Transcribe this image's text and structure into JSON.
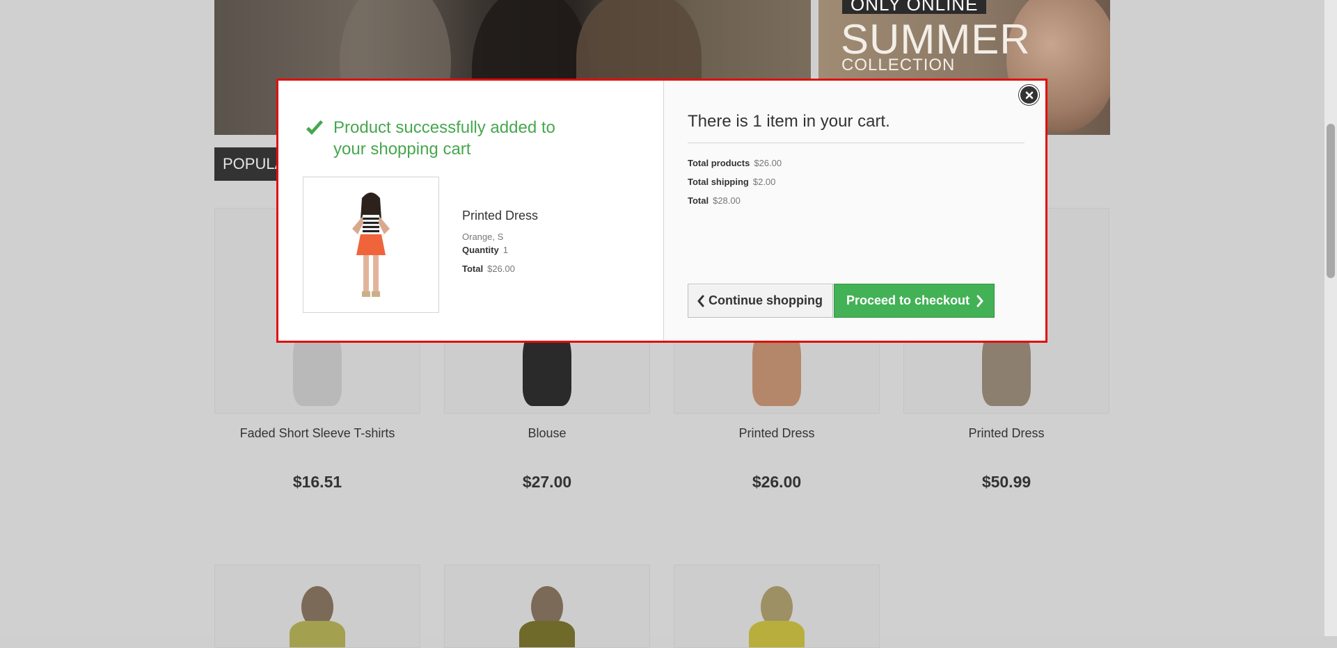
{
  "banner": {
    "right_tag": "ONLY ONLINE",
    "right_title": "SUMMER",
    "right_subtitle": "COLLECTION"
  },
  "section": {
    "tab_label": "POPULAR"
  },
  "products": [
    {
      "name": "Faded Short Sleeve T-shirts",
      "price": "$16.51"
    },
    {
      "name": "Blouse",
      "price": "$27.00"
    },
    {
      "name": "Printed Dress",
      "price": "$26.00"
    },
    {
      "name": "Printed Dress",
      "price": "$50.99"
    }
  ],
  "modal": {
    "success_message": "Product successfully added to your shopping cart",
    "product": {
      "name": "Printed Dress",
      "attributes": "Orange, S",
      "quantity_label": "Quantity",
      "quantity": "1",
      "total_label": "Total",
      "total": "$26.00"
    },
    "cart": {
      "title": "There is 1 item in your cart.",
      "total_products_label": "Total products",
      "total_products": "$26.00",
      "total_shipping_label": "Total shipping",
      "total_shipping": "$2.00",
      "total_label": "Total",
      "total": "$28.00"
    },
    "continue_label": "Continue shopping",
    "checkout_label": "Proceed to checkout"
  },
  "colors": {
    "success_green": "#46a74e",
    "checkout_button": "#43b155",
    "modal_border": "#e10e0e",
    "overlay": "#d0d0d0"
  },
  "icons": [
    "check-icon",
    "close-icon",
    "chevron-left-icon",
    "chevron-right-icon"
  ]
}
